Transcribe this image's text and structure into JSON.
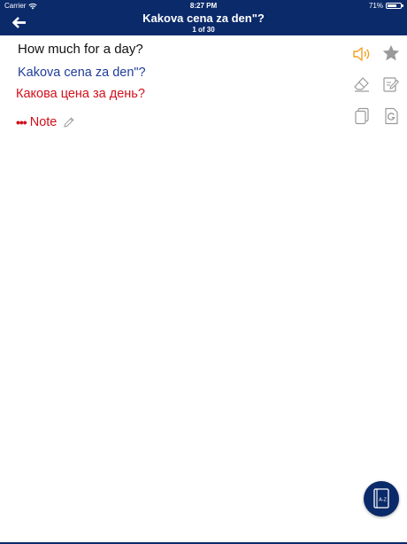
{
  "status_bar": {
    "carrier": "Carrier",
    "time": "8:27 PM",
    "battery": "71%",
    "battery_level": 0.71
  },
  "header": {
    "title": "Kakova cena za den\"?",
    "counter": "1 of 30"
  },
  "phrase": {
    "english": "How much for a day?",
    "transliteration": "Kakova cena za den\"?",
    "cyrillic": "Какова цена за день?"
  },
  "note": {
    "label": "Note"
  },
  "colors": {
    "header_bg": "#0b2a6a",
    "accent_orange": "#f0a020",
    "translit_blue": "#1f3d99",
    "cyrillic_red": "#d0101a",
    "icon_gray": "#9a9a9a"
  },
  "icons": {
    "back": "back-arrow-icon",
    "speaker": "speaker-icon",
    "favorite": "star-icon",
    "eraser": "eraser-icon",
    "edit": "edit-note-icon",
    "copy": "copy-icon",
    "google": "google-translate-icon",
    "dictionary": "dictionary-icon"
  },
  "dictionary_badge": "A-Z"
}
